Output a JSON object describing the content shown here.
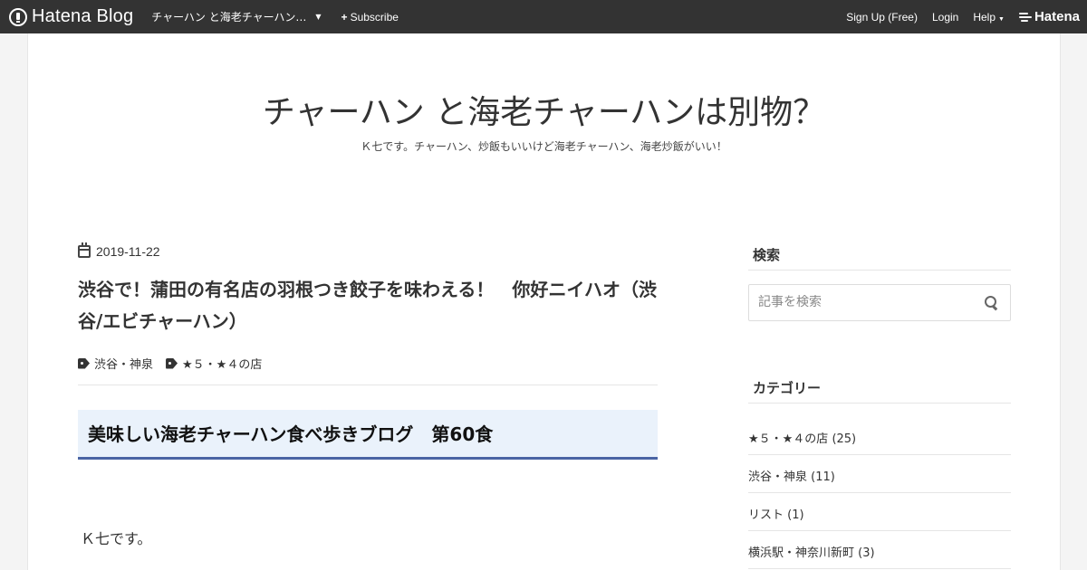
{
  "topbar": {
    "brand": "Hatena Blog",
    "blog_selector": "チャーハン と海老チャーハン…",
    "subscribe": "Subscribe",
    "signup": "Sign Up (Free)",
    "login": "Login",
    "help": "Help",
    "hatena": "Hatena",
    "bg_color": "#333333"
  },
  "blog": {
    "title": "チャーハン と海老チャーハンは別物？",
    "description": "Ｋ七です。チャーハン、炒飯もいいけど海老チャーハン、海老炒飯がいい！"
  },
  "entry": {
    "date": "2019-11-22",
    "title": "渋谷で！蒲田の有名店の羽根つき餃子を味わえる！　你好ニイハオ（渋谷/エビチャーハン）",
    "tags": [
      "渋谷・神泉",
      "★５・★４の店"
    ],
    "heading": "美味しい海老チャーハン食べ歩きブログ　第60食",
    "heading_bg": "#eaf2fb",
    "heading_border": "#4a64a4",
    "body_first_line": "Ｋ七です。"
  },
  "sidebar": {
    "search_title": "検索",
    "search_placeholder": "記事を検索",
    "category_title": "カテゴリー",
    "categories": [
      "★５・★４の店 (25)",
      "渋谷・神泉 (11)",
      "リスト (1)",
      "横浜駅・神奈川新町 (3)"
    ]
  },
  "icons": [
    "hatena-blog-icon",
    "plus-icon",
    "chevron-down-icon",
    "hatena-logo-icon",
    "calendar-icon",
    "tag-icon",
    "search-icon"
  ]
}
